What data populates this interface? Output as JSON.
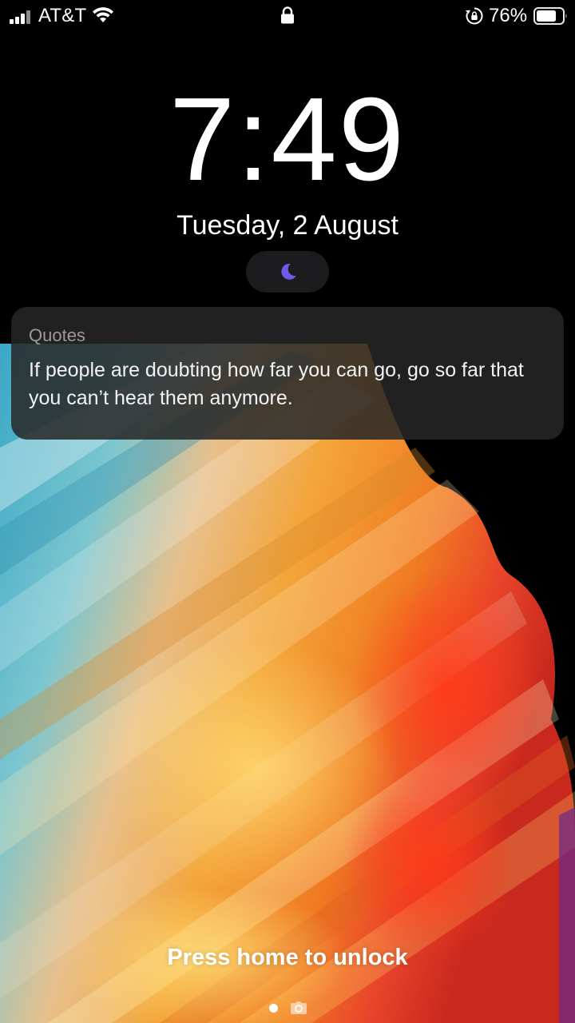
{
  "status_bar": {
    "carrier": "AT&T",
    "battery_percent": "76%",
    "icons": [
      "signal-icon",
      "wifi-icon",
      "lock-icon",
      "rotation-lock-icon",
      "battery-icon"
    ]
  },
  "lock_screen": {
    "time": "7:49",
    "date": "Tuesday, 2 August",
    "focus_icon": "moon-icon",
    "focus_color": "#6b5ce7"
  },
  "notification": {
    "app": "Quotes",
    "body": "If people are doubting how far you can go, go so far that you can’t hear them anymore."
  },
  "footer": {
    "unlock_hint": "Press home to unlock",
    "icons": [
      "page-dot",
      "camera-icon"
    ]
  }
}
